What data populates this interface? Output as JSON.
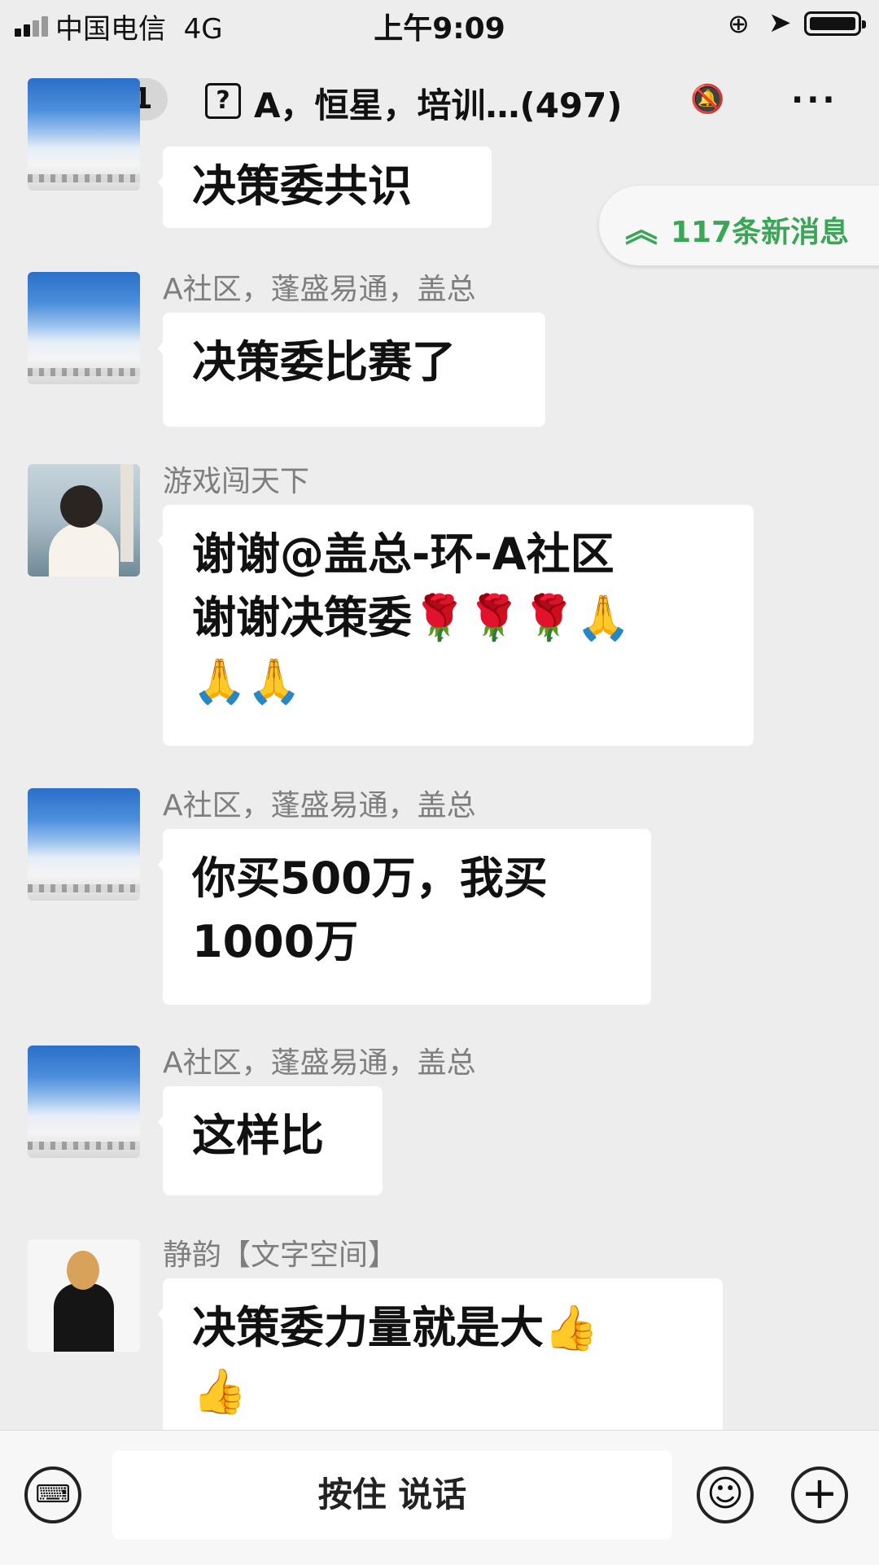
{
  "status_bar": {
    "carrier": "中国电信",
    "network": "4G",
    "time": "上午9:09"
  },
  "nav": {
    "back_count": "821",
    "group_icon": "?",
    "title": "A，恒星，培训…",
    "member_count": "(497)",
    "more": "···"
  },
  "new_messages": {
    "text": "117条新消息"
  },
  "messages": [
    {
      "sender": "",
      "text": "决策委共识"
    },
    {
      "sender": "A社区，蓬盛易通，盖总",
      "text": "决策委比赛了"
    },
    {
      "sender": "游戏闯天下",
      "lines": [
        "谢谢@盖总-环-A社区",
        "谢谢决策委🌹🌹🌹🙏",
        "🙏🙏"
      ]
    },
    {
      "sender": "A社区，蓬盛易通，盖总",
      "lines": [
        "你买500万，我买",
        "1000万"
      ]
    },
    {
      "sender": "A社区，蓬盛易通，盖总",
      "text": "这样比"
    },
    {
      "sender": "静韵【文字空间】",
      "lines": [
        "决策委力量就是大👍",
        "👍"
      ]
    }
  ],
  "input_bar": {
    "hold_to_talk": "按住 说话"
  },
  "colors": {
    "background": "#ededed",
    "accent_green": "#3aa757",
    "bubble": "#ffffff"
  },
  "icons": [
    "signal-icon",
    "battery-icon",
    "back-arrow-icon",
    "mute-bell-icon",
    "more-icon",
    "chevron-up-double-icon",
    "keyboard-icon",
    "emoji-icon",
    "plus-icon"
  ]
}
